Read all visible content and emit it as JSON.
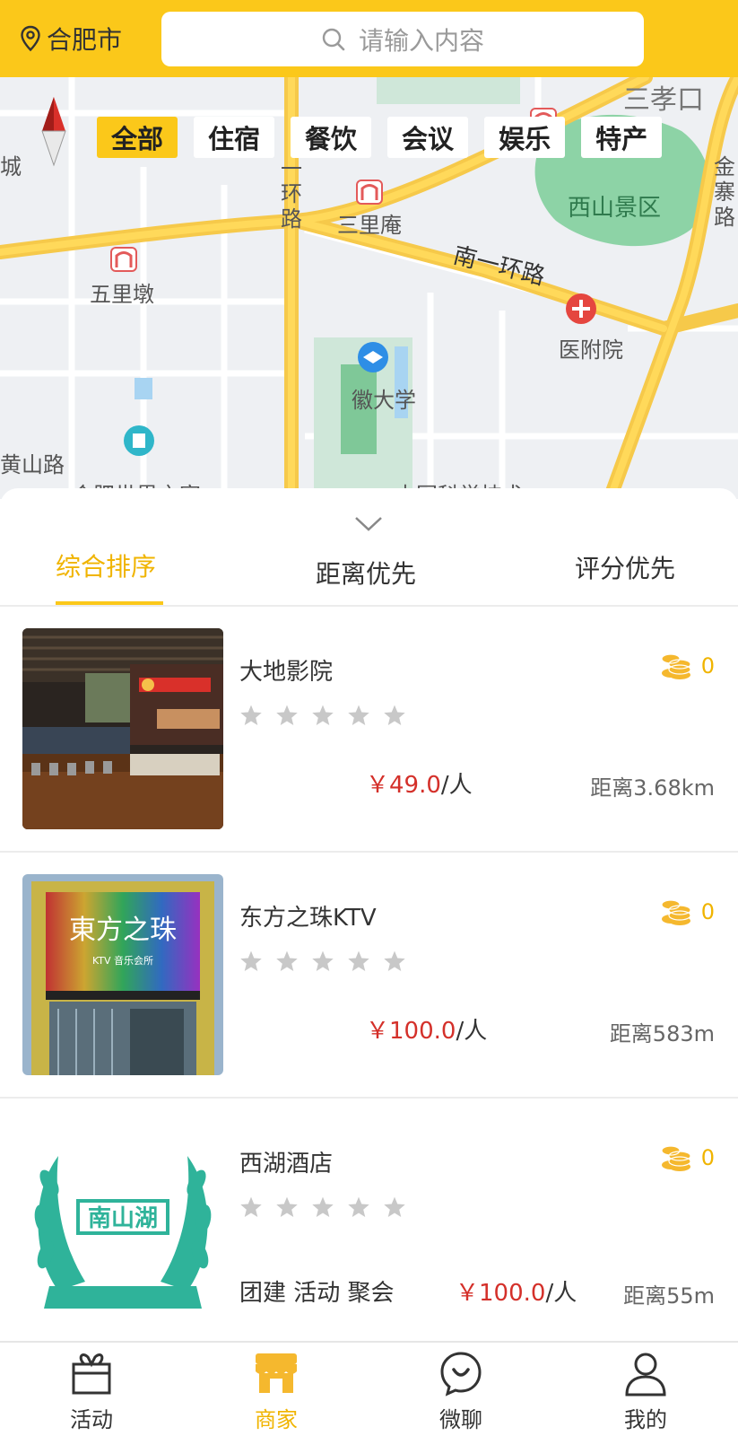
{
  "header": {
    "city": "合肥市",
    "search_placeholder": "请输入内容"
  },
  "map": {
    "labels": [
      "三孝口",
      "城",
      "金寨路",
      "西山景区",
      "一环路",
      "三里庵",
      "南一环路",
      "五里墩",
      "医附院",
      "徽大学",
      "黄山路",
      "合肥世界之窗",
      "中国科学技术"
    ],
    "categories": [
      {
        "label": "全部",
        "active": true
      },
      {
        "label": "住宿",
        "active": false
      },
      {
        "label": "餐饮",
        "active": false
      },
      {
        "label": "会议",
        "active": false
      },
      {
        "label": "娱乐",
        "active": false
      },
      {
        "label": "特产",
        "active": false
      }
    ]
  },
  "sort": {
    "tabs": [
      {
        "label": "综合排序",
        "active": true
      },
      {
        "label": "距离优先",
        "active": false
      },
      {
        "label": "评分优先",
        "active": false
      }
    ]
  },
  "merchants": [
    {
      "name": "大地影院",
      "coins": "0",
      "rating": 0,
      "price_prefix": "￥",
      "price": "49.0",
      "price_unit": "/人",
      "distance": "距离3.68km",
      "tags": ""
    },
    {
      "name": "东方之珠KTV",
      "coins": "0",
      "rating": 0,
      "price_prefix": "￥",
      "price": "100.0",
      "price_unit": "/人",
      "distance": "距离583m",
      "tags": "",
      "thumb_text": "KTV 音乐会所"
    },
    {
      "name": "西湖酒店",
      "coins": "0",
      "rating": 0,
      "price_prefix": "￥",
      "price": "100.0",
      "price_unit": "/人",
      "distance": "距离55m",
      "tags": "团建 活动 聚会",
      "thumb_text": "南山湖"
    }
  ],
  "nav": {
    "items": [
      {
        "label": "活动",
        "icon": "gift-icon",
        "active": false
      },
      {
        "label": "商家",
        "icon": "shop-icon",
        "active": true
      },
      {
        "label": "微聊",
        "icon": "chat-icon",
        "active": false
      },
      {
        "label": "我的",
        "icon": "user-icon",
        "active": false
      }
    ]
  },
  "colors": {
    "brand": "#fbc81a",
    "active_text": "#f0b400",
    "price": "#d4302a"
  }
}
